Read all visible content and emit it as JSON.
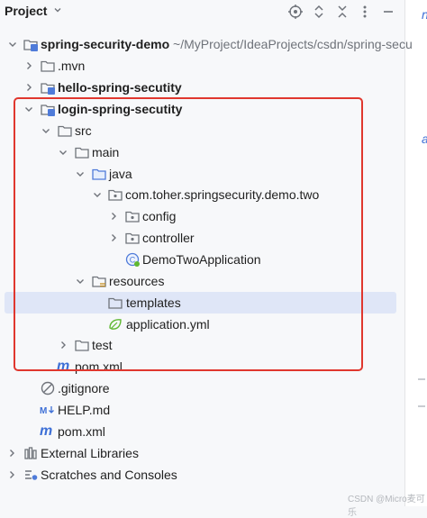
{
  "panel": {
    "title": "Project"
  },
  "tree": [
    {
      "label": "spring-security-demo",
      "suffix": " ~/MyProject/IdeaProjects/csdn/spring-secu",
      "bold": true
    },
    {
      "label": ".mvn"
    },
    {
      "label": "hello-spring-secutity",
      "bold": true
    },
    {
      "label": "login-spring-secutity",
      "bold": true
    },
    {
      "label": "src"
    },
    {
      "label": "main"
    },
    {
      "label": "java"
    },
    {
      "label": "com.toher.springsecurity.demo.two"
    },
    {
      "label": "config"
    },
    {
      "label": "controller"
    },
    {
      "label": "DemoTwoApplication"
    },
    {
      "label": "resources"
    },
    {
      "label": "templates"
    },
    {
      "label": "application.yml"
    },
    {
      "label": "test"
    },
    {
      "label": "pom.xml"
    },
    {
      "label": ".gitignore"
    },
    {
      "label": "HELP.md"
    },
    {
      "label": "pom.xml"
    },
    {
      "label": "External Libraries"
    },
    {
      "label": "Scratches and Consoles"
    }
  ],
  "strip": {
    "glyph": "n",
    "glyph2": "a"
  },
  "watermark": "CSDN @Micro麦可乐",
  "colors": {
    "folder": "#6f737a",
    "module": "#4f7bd9",
    "selection": "#dfe6f7",
    "highlight": "#e0372e",
    "maven": "#3d6fd6"
  }
}
